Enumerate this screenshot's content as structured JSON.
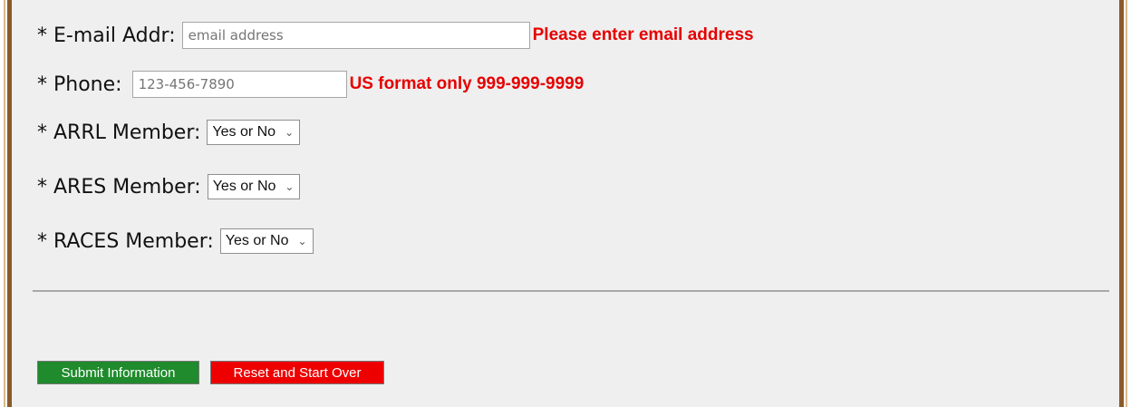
{
  "form": {
    "email": {
      "label": "* E-mail Addr:",
      "placeholder": "email address",
      "error": "Please enter email address"
    },
    "phone": {
      "label": "* Phone:",
      "placeholder": "123-456-7890",
      "error": "US format only 999-999-9999"
    },
    "arrl": {
      "label": "* ARRL Member:",
      "selected": "Yes or No"
    },
    "ares": {
      "label": "* ARES Member:",
      "selected": "Yes or No"
    },
    "races": {
      "label": "* RACES Member:",
      "selected": "Yes or No"
    }
  },
  "buttons": {
    "submit": "Submit Information",
    "reset": "Reset and Start Over"
  },
  "colors": {
    "frame_border": "#8b5a2b",
    "panel_bg": "#efefef",
    "error": "#e60000",
    "submit_bg": "#1f8b2c",
    "reset_bg": "#ee0000"
  },
  "icons": {
    "dropdown": "chevron-down-icon"
  }
}
